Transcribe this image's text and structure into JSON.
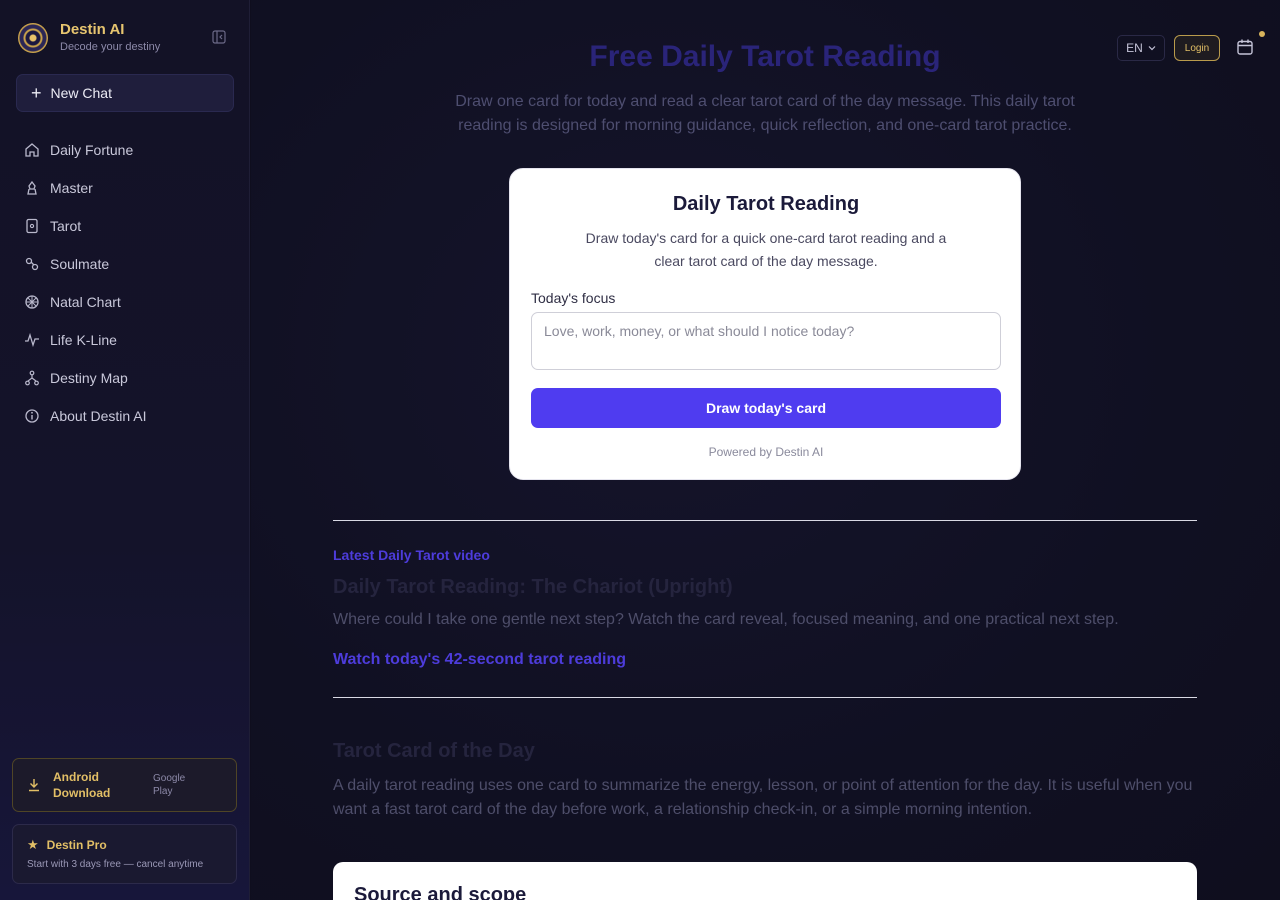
{
  "sidebar": {
    "brand_title": "Destin AI",
    "brand_sub": "Decode your destiny",
    "new_chat": "New Chat",
    "items": [
      {
        "label": "Daily Fortune",
        "icon": "home-icon"
      },
      {
        "label": "Master",
        "icon": "master-icon"
      },
      {
        "label": "Tarot",
        "icon": "tarot-card-icon"
      },
      {
        "label": "Soulmate",
        "icon": "soulmate-icon"
      },
      {
        "label": "Natal Chart",
        "icon": "natal-wheel-icon"
      },
      {
        "label": "Life K-Line",
        "icon": "pulse-line-icon"
      },
      {
        "label": "Destiny Map",
        "icon": "tree-map-icon"
      },
      {
        "label": "About Destin AI",
        "icon": "info-icon"
      }
    ],
    "android_label_1": "Android",
    "android_label_2": "Download",
    "android_store_1": "Google",
    "android_store_2": "Play",
    "pro_title": "Destin Pro",
    "pro_sub": "Start with 3 days free — cancel anytime"
  },
  "topbar": {
    "lang": "EN",
    "login": "Login"
  },
  "hero": {
    "title": "Free Daily Tarot Reading",
    "desc": "Draw one card for today and read a clear tarot card of the day message. This daily tarot reading is designed for morning guidance, quick reflection, and one-card tarot practice."
  },
  "card": {
    "title": "Daily Tarot Reading",
    "desc": "Draw today's card for a quick one-card tarot reading and a clear tarot card of the day message.",
    "focus_label": "Today's focus",
    "focus_placeholder": "Love, work, money, or what should I notice today?",
    "button": "Draw today's card",
    "powered": "Powered by Destin AI"
  },
  "video": {
    "kicker": "Latest Daily Tarot video",
    "title": "Daily Tarot Reading: The Chariot (Upright)",
    "desc": "Where could I take one gentle next step? Watch the card reveal, focused meaning, and one practical next step.",
    "link": "Watch today's 42-second tarot reading"
  },
  "section": {
    "title": "Tarot Card of the Day",
    "desc": "A daily tarot reading uses one card to summarize the energy, lesson, or point of attention for the day. It is useful when you want a fast tarot card of the day before work, a relationship check-in, or a simple morning intention."
  },
  "source": {
    "title": "Source and scope"
  },
  "colors": {
    "accent": "#4f3cf0",
    "gold": "#e2bf66",
    "sidebar_bg": "#131226"
  }
}
